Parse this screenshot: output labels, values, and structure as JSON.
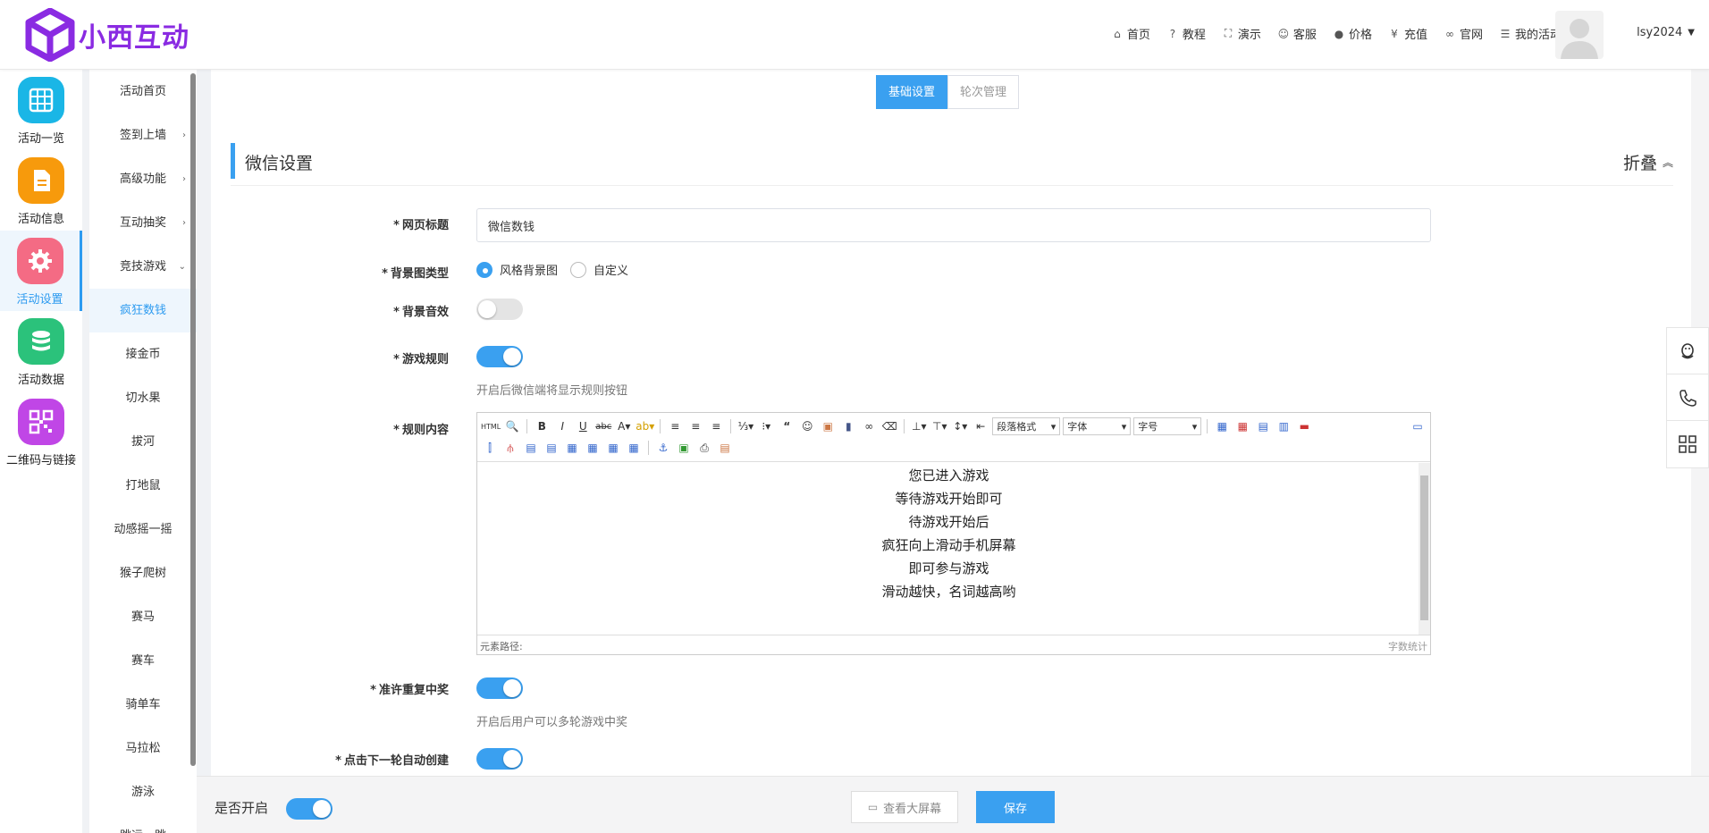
{
  "brand": {
    "name": "小西互动",
    "color": "#8a2be2"
  },
  "topnav": [
    {
      "icon": "home-icon",
      "glyph": "⌂",
      "label": "首页"
    },
    {
      "icon": "help-icon",
      "glyph": "?",
      "label": "教程"
    },
    {
      "icon": "fullscreen-icon",
      "glyph": "⛶",
      "label": "演示"
    },
    {
      "icon": "smile-icon",
      "glyph": "☺",
      "label": "客服"
    },
    {
      "icon": "info-icon",
      "glyph": "●",
      "label": "价格"
    },
    {
      "icon": "yen-icon",
      "glyph": "¥",
      "label": "充值"
    },
    {
      "icon": "link-icon",
      "glyph": "∞",
      "label": "官网"
    },
    {
      "icon": "list-icon",
      "glyph": "☰",
      "label": "我的活动"
    }
  ],
  "user": {
    "name": "lsy2024"
  },
  "iconbar": [
    {
      "label": "活动一览",
      "color": "#1ab6e6",
      "active": false
    },
    {
      "label": "活动信息",
      "color": "#f79a0c",
      "active": false
    },
    {
      "label": "活动设置",
      "color": "#f46b84",
      "active": true
    },
    {
      "label": "活动数据",
      "color": "#2bc27b",
      "active": false
    },
    {
      "label": "二维码与链接",
      "color": "#c046e6",
      "active": false
    }
  ],
  "subnav": [
    {
      "label": "活动首页",
      "arrow": ""
    },
    {
      "label": "签到上墙",
      "arrow": "›"
    },
    {
      "label": "高级功能",
      "arrow": "›"
    },
    {
      "label": "互动抽奖",
      "arrow": "›"
    },
    {
      "label": "竞技游戏",
      "arrow": "⌄"
    },
    {
      "label": "疯狂数钱",
      "arrow": "",
      "active": true
    },
    {
      "label": "接金币",
      "arrow": ""
    },
    {
      "label": "切水果",
      "arrow": ""
    },
    {
      "label": "拔河",
      "arrow": ""
    },
    {
      "label": "打地鼠",
      "arrow": ""
    },
    {
      "label": "动感摇一摇",
      "arrow": ""
    },
    {
      "label": "猴子爬树",
      "arrow": ""
    },
    {
      "label": "赛马",
      "arrow": ""
    },
    {
      "label": "赛车",
      "arrow": ""
    },
    {
      "label": "骑单车",
      "arrow": ""
    },
    {
      "label": "马拉松",
      "arrow": ""
    },
    {
      "label": "游泳",
      "arrow": ""
    },
    {
      "label": "跳远一跳",
      "arrow": ""
    }
  ],
  "tabs": {
    "basic": "基础设置",
    "rounds": "轮次管理"
  },
  "section": {
    "title": "微信设置",
    "collapse": "折叠"
  },
  "form": {
    "page_title": {
      "label": "网页标题",
      "value": "微信数钱"
    },
    "bg_type": {
      "label": "背景图类型",
      "options": [
        "风格背景图",
        "自定义"
      ],
      "selected": 0
    },
    "bg_sound": {
      "label": "背景音效",
      "on": false
    },
    "game_rules": {
      "label": "游戏规则",
      "on": true,
      "hint": "开启后微信端将显示规则按钮"
    },
    "rule_content": {
      "label": "规则内容",
      "lines": [
        "您已进入游戏",
        "等待游戏开始即可",
        "待游戏开始后",
        "疯狂向上滑动手机屏幕",
        "即可参与游戏",
        "滑动越快，名词越高哟"
      ],
      "path_label": "元素路径:",
      "count_label": "字数统计"
    },
    "repeat_win": {
      "label": "准许重复中奖",
      "on": true,
      "hint": "开启后用户可以多轮游戏中奖"
    },
    "auto_create": {
      "label": "点击下一轮自动创建",
      "on": true
    }
  },
  "editor_toolbar": {
    "paragraph": "段落格式",
    "font": "字体",
    "size": "字号"
  },
  "bottom": {
    "enable_label": "是否开启",
    "enabled": true,
    "screen_button": "查看大屏幕",
    "save_button": "保存"
  },
  "accent": "#3aa0f0"
}
